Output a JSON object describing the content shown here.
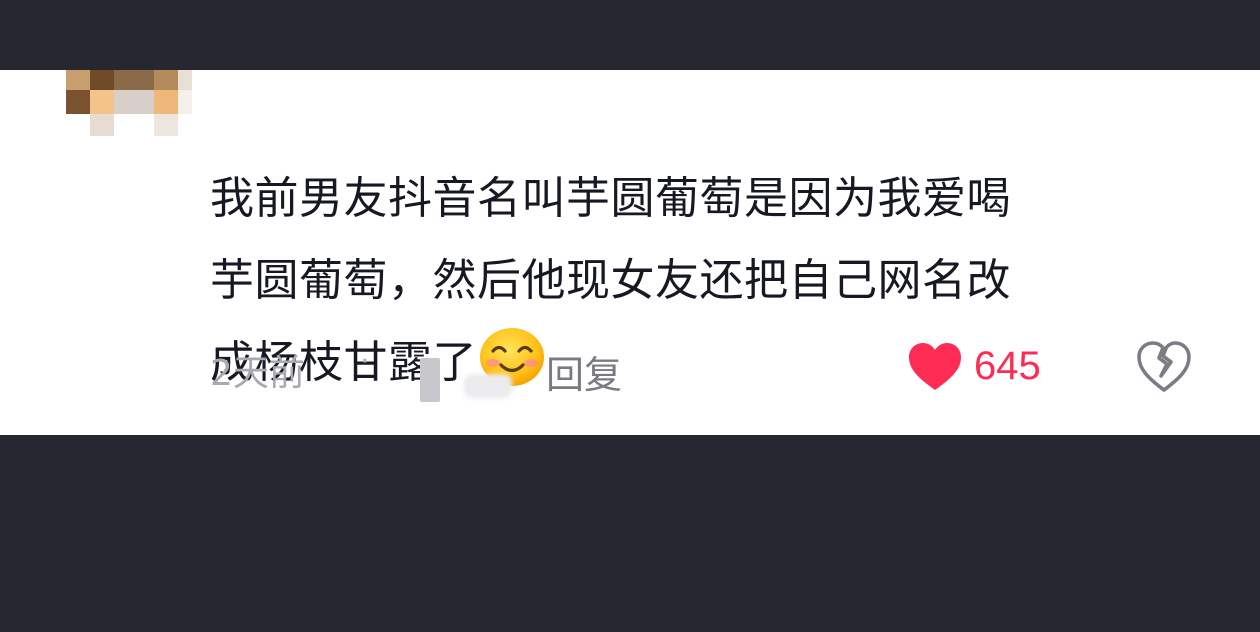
{
  "comment": {
    "lines": [
      "我前男友抖音名叫芋圆葡萄是因为我爱喝",
      "芋圆葡萄，然后他现女友还把自己网名改",
      "成杨枝甘露了"
    ],
    "emoji": "smiling-face-emoji"
  },
  "meta": {
    "time": "2天前",
    "separator": "·",
    "reply_label": "回复",
    "like_count": "645"
  },
  "colors": {
    "background_dark": "#272731",
    "card": "#ffffff",
    "text_primary": "#161823",
    "text_secondary": "#a9aab0",
    "like_red": "#fe2c55"
  },
  "icons": {
    "like": "heart-icon",
    "dislike": "broken-heart-icon",
    "avatar": "pixelated-avatar"
  }
}
